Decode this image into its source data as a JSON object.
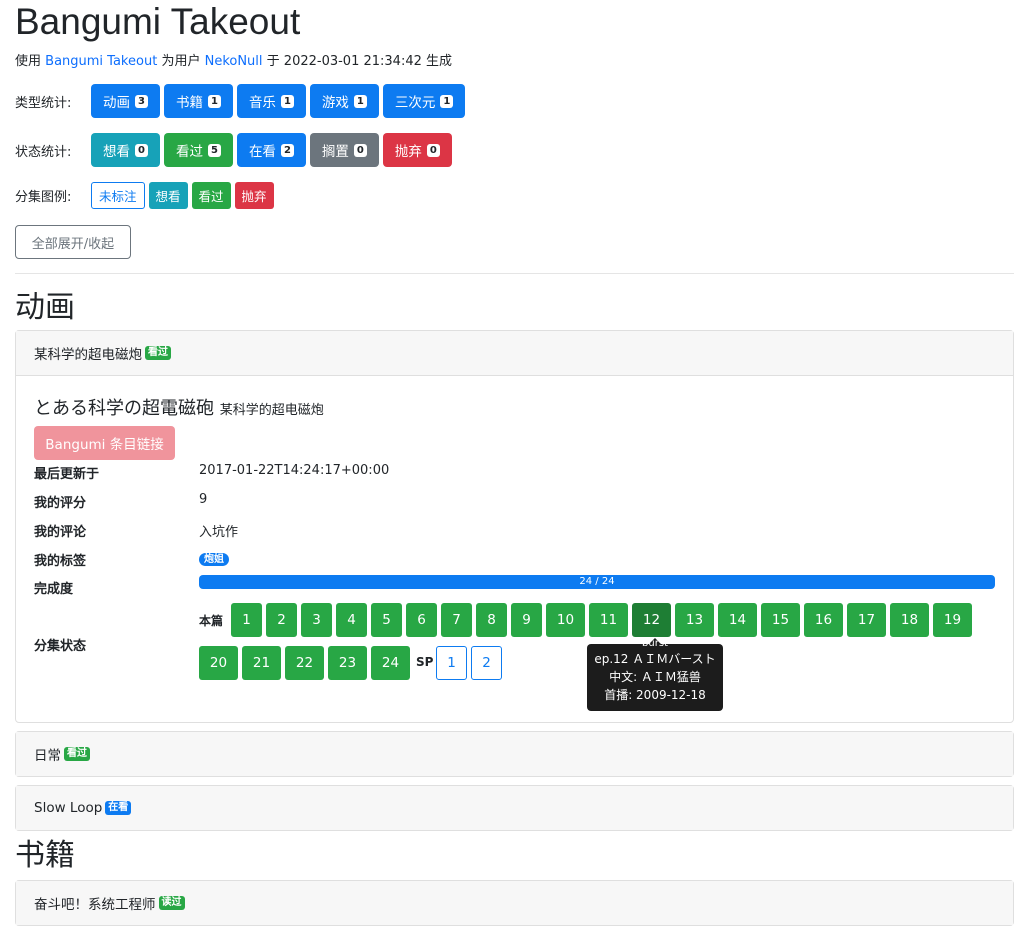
{
  "header": {
    "title": "Bangumi Takeout",
    "sub_prefix": "使用",
    "sub_link": "Bangumi Takeout",
    "sub_mid": "为用户",
    "user": "NekoNull",
    "sub_time": "于 2022-03-01 21:34:42 生成"
  },
  "type_stats": {
    "label": "类型统计:",
    "items": [
      {
        "label": "动画",
        "count": "3"
      },
      {
        "label": "书籍",
        "count": "1"
      },
      {
        "label": "音乐",
        "count": "1"
      },
      {
        "label": "游戏",
        "count": "1"
      },
      {
        "label": "三次元",
        "count": "1"
      }
    ]
  },
  "status_stats": {
    "label": "状态统计:",
    "items": [
      {
        "label": "想看",
        "count": "0",
        "color": "#17a2b8"
      },
      {
        "label": "看过",
        "count": "5",
        "color": "#28a745"
      },
      {
        "label": "在看",
        "count": "2",
        "color": "#0d7bf1"
      },
      {
        "label": "搁置",
        "count": "0",
        "color": "#6c757d"
      },
      {
        "label": "抛弃",
        "count": "0",
        "color": "#dc3545"
      }
    ]
  },
  "legend": {
    "label": "分集图例:",
    "items": [
      "未标注",
      "想看",
      "看过",
      "抛弃"
    ]
  },
  "toggle_all": "全部展开/收起",
  "anime": {
    "heading": "动画",
    "open_card": {
      "title": "某科学的超电磁炮",
      "badge": "看过",
      "jp_title": "とある科学の超電磁砲",
      "cn_title": "某科学的超电磁炮",
      "link_label": "Bangumi 条目链接",
      "fields": {
        "updated_label": "最后更新于",
        "updated": "2017-01-22T14:24:17+00:00",
        "rating_label": "我的评分",
        "rating": "9",
        "comment_label": "我的评论",
        "comment": "入坑作",
        "tags_label": "我的标签",
        "tag": "炮姐",
        "progress_label": "完成度",
        "progress_text": "24 / 24",
        "progress": 1.0,
        "episodes_label": "分集状态"
      },
      "main_label": "本篇",
      "sp_label": "SP",
      "main_eps": [
        "1",
        "2",
        "3",
        "4",
        "5",
        "6",
        "7",
        "8",
        "9",
        "10",
        "11",
        "12",
        "13",
        "14",
        "15",
        "16",
        "17",
        "18",
        "19",
        "20",
        "21",
        "22",
        "23",
        "24"
      ],
      "sp_eps": [
        "1",
        "2"
      ],
      "tooltip": {
        "tiny": "burst",
        "line1": "ep.12 ＡＩＭバースト",
        "line2": "中文: ＡＩＭ猛兽",
        "line3": "首播: 2009-12-18"
      }
    },
    "cards": [
      {
        "title": "日常",
        "badge": "看过"
      },
      {
        "title": "Slow Loop",
        "badge": "在看"
      }
    ]
  },
  "books": {
    "heading": "书籍",
    "cards": [
      {
        "title": "奋斗吧！系统工程师",
        "badge": "读过"
      }
    ]
  }
}
